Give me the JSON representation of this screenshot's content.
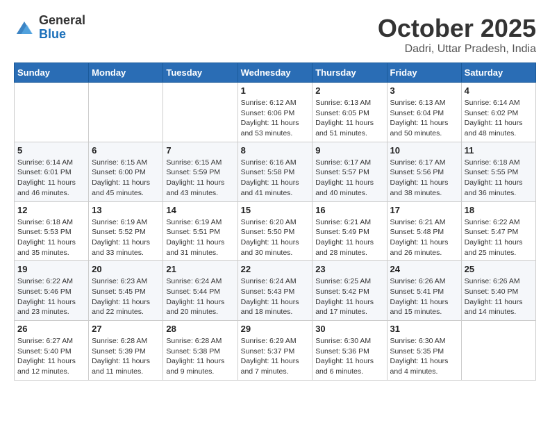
{
  "logo": {
    "general": "General",
    "blue": "Blue"
  },
  "header": {
    "month": "October 2025",
    "location": "Dadri, Uttar Pradesh, India"
  },
  "weekdays": [
    "Sunday",
    "Monday",
    "Tuesday",
    "Wednesday",
    "Thursday",
    "Friday",
    "Saturday"
  ],
  "weeks": [
    [
      {
        "day": "",
        "info": ""
      },
      {
        "day": "",
        "info": ""
      },
      {
        "day": "",
        "info": ""
      },
      {
        "day": "1",
        "info": "Sunrise: 6:12 AM\nSunset: 6:06 PM\nDaylight: 11 hours\nand 53 minutes."
      },
      {
        "day": "2",
        "info": "Sunrise: 6:13 AM\nSunset: 6:05 PM\nDaylight: 11 hours\nand 51 minutes."
      },
      {
        "day": "3",
        "info": "Sunrise: 6:13 AM\nSunset: 6:04 PM\nDaylight: 11 hours\nand 50 minutes."
      },
      {
        "day": "4",
        "info": "Sunrise: 6:14 AM\nSunset: 6:02 PM\nDaylight: 11 hours\nand 48 minutes."
      }
    ],
    [
      {
        "day": "5",
        "info": "Sunrise: 6:14 AM\nSunset: 6:01 PM\nDaylight: 11 hours\nand 46 minutes."
      },
      {
        "day": "6",
        "info": "Sunrise: 6:15 AM\nSunset: 6:00 PM\nDaylight: 11 hours\nand 45 minutes."
      },
      {
        "day": "7",
        "info": "Sunrise: 6:15 AM\nSunset: 5:59 PM\nDaylight: 11 hours\nand 43 minutes."
      },
      {
        "day": "8",
        "info": "Sunrise: 6:16 AM\nSunset: 5:58 PM\nDaylight: 11 hours\nand 41 minutes."
      },
      {
        "day": "9",
        "info": "Sunrise: 6:17 AM\nSunset: 5:57 PM\nDaylight: 11 hours\nand 40 minutes."
      },
      {
        "day": "10",
        "info": "Sunrise: 6:17 AM\nSunset: 5:56 PM\nDaylight: 11 hours\nand 38 minutes."
      },
      {
        "day": "11",
        "info": "Sunrise: 6:18 AM\nSunset: 5:55 PM\nDaylight: 11 hours\nand 36 minutes."
      }
    ],
    [
      {
        "day": "12",
        "info": "Sunrise: 6:18 AM\nSunset: 5:53 PM\nDaylight: 11 hours\nand 35 minutes."
      },
      {
        "day": "13",
        "info": "Sunrise: 6:19 AM\nSunset: 5:52 PM\nDaylight: 11 hours\nand 33 minutes."
      },
      {
        "day": "14",
        "info": "Sunrise: 6:19 AM\nSunset: 5:51 PM\nDaylight: 11 hours\nand 31 minutes."
      },
      {
        "day": "15",
        "info": "Sunrise: 6:20 AM\nSunset: 5:50 PM\nDaylight: 11 hours\nand 30 minutes."
      },
      {
        "day": "16",
        "info": "Sunrise: 6:21 AM\nSunset: 5:49 PM\nDaylight: 11 hours\nand 28 minutes."
      },
      {
        "day": "17",
        "info": "Sunrise: 6:21 AM\nSunset: 5:48 PM\nDaylight: 11 hours\nand 26 minutes."
      },
      {
        "day": "18",
        "info": "Sunrise: 6:22 AM\nSunset: 5:47 PM\nDaylight: 11 hours\nand 25 minutes."
      }
    ],
    [
      {
        "day": "19",
        "info": "Sunrise: 6:22 AM\nSunset: 5:46 PM\nDaylight: 11 hours\nand 23 minutes."
      },
      {
        "day": "20",
        "info": "Sunrise: 6:23 AM\nSunset: 5:45 PM\nDaylight: 11 hours\nand 22 minutes."
      },
      {
        "day": "21",
        "info": "Sunrise: 6:24 AM\nSunset: 5:44 PM\nDaylight: 11 hours\nand 20 minutes."
      },
      {
        "day": "22",
        "info": "Sunrise: 6:24 AM\nSunset: 5:43 PM\nDaylight: 11 hours\nand 18 minutes."
      },
      {
        "day": "23",
        "info": "Sunrise: 6:25 AM\nSunset: 5:42 PM\nDaylight: 11 hours\nand 17 minutes."
      },
      {
        "day": "24",
        "info": "Sunrise: 6:26 AM\nSunset: 5:41 PM\nDaylight: 11 hours\nand 15 minutes."
      },
      {
        "day": "25",
        "info": "Sunrise: 6:26 AM\nSunset: 5:40 PM\nDaylight: 11 hours\nand 14 minutes."
      }
    ],
    [
      {
        "day": "26",
        "info": "Sunrise: 6:27 AM\nSunset: 5:40 PM\nDaylight: 11 hours\nand 12 minutes."
      },
      {
        "day": "27",
        "info": "Sunrise: 6:28 AM\nSunset: 5:39 PM\nDaylight: 11 hours\nand 11 minutes."
      },
      {
        "day": "28",
        "info": "Sunrise: 6:28 AM\nSunset: 5:38 PM\nDaylight: 11 hours\nand 9 minutes."
      },
      {
        "day": "29",
        "info": "Sunrise: 6:29 AM\nSunset: 5:37 PM\nDaylight: 11 hours\nand 7 minutes."
      },
      {
        "day": "30",
        "info": "Sunrise: 6:30 AM\nSunset: 5:36 PM\nDaylight: 11 hours\nand 6 minutes."
      },
      {
        "day": "31",
        "info": "Sunrise: 6:30 AM\nSunset: 5:35 PM\nDaylight: 11 hours\nand 4 minutes."
      },
      {
        "day": "",
        "info": ""
      }
    ]
  ]
}
